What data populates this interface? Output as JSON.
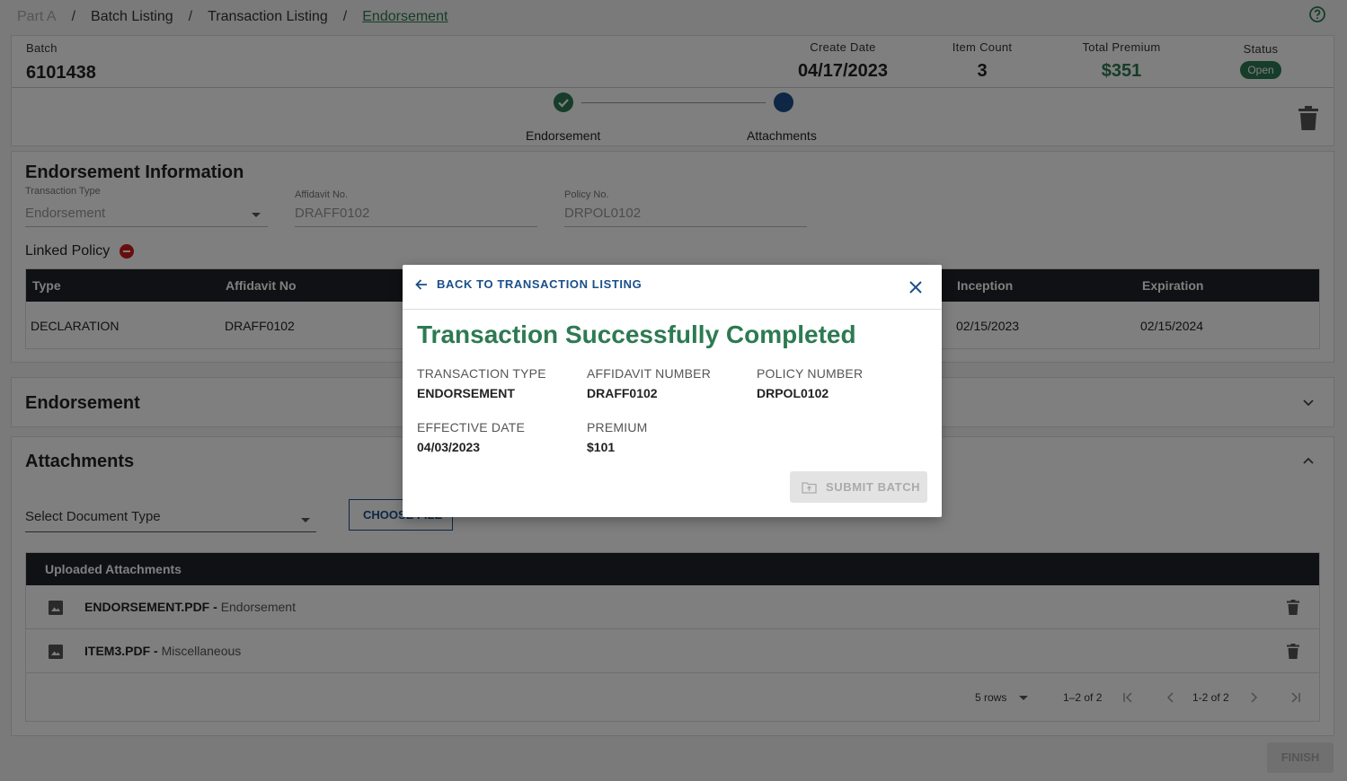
{
  "breadcrumb": {
    "items": [
      "Part A",
      "Batch Listing",
      "Transaction Listing",
      "Endorsement"
    ],
    "separator": "/"
  },
  "batch": {
    "batch_label": "Batch",
    "batch_value": "6101438",
    "create_date_label": "Create Date",
    "create_date_value": "04/17/2023",
    "item_count_label": "Item Count",
    "item_count_value": "3",
    "total_premium_label": "Total Premium",
    "total_premium_value": "$351",
    "status_label": "Status",
    "status_value": "Open"
  },
  "stepper": {
    "steps": [
      "Endorsement",
      "Attachments"
    ]
  },
  "endorsement_info": {
    "title": "Endorsement Information",
    "transaction_type_label": "Transaction Type",
    "transaction_type_value": "Endorsement",
    "affidavit_label": "Affidavit No.",
    "affidavit_value": "DRAFF0102",
    "policy_label": "Policy No.",
    "policy_value": "DRPOL0102",
    "linked_policy_label": "Linked Policy",
    "table": {
      "headers": [
        "Type",
        "Affidavit No",
        "Inception",
        "Expiration"
      ],
      "row": [
        "DECLARATION",
        "DRAFF0102",
        "02/15/2023",
        "02/15/2024"
      ]
    }
  },
  "endorsement_section": {
    "title": "Endorsement"
  },
  "attachments": {
    "title": "Attachments",
    "select_placeholder": "Select Document Type",
    "choose_file_label": "CHOOSE FILE",
    "table_title": "Uploaded Attachments",
    "rows": [
      {
        "file": "ENDORSEMENT.PDF -",
        "type": "Endorsement"
      },
      {
        "file": "ITEM3.PDF -",
        "type": "Miscellaneous"
      }
    ],
    "pager": {
      "rows_per_page": "5 rows",
      "range": "1–2 of 2",
      "range2": "1-2 of 2"
    }
  },
  "finish_label": "FINISH",
  "modal": {
    "back_label": "BACK TO TRANSACTION LISTING",
    "title": "Transaction Successfully Completed",
    "transaction_type_label": "TRANSACTION TYPE",
    "transaction_type_value": "ENDORSEMENT",
    "affidavit_label": "AFFIDAVIT NUMBER",
    "affidavit_value": "DRAFF0102",
    "policy_label": "POLICY NUMBER",
    "policy_value": "DRPOL0102",
    "effective_label": "EFFECTIVE DATE",
    "effective_value": "04/03/2023",
    "premium_label": "PREMIUM",
    "premium_value": "$101",
    "submit_label": "SUBMIT BATCH"
  },
  "colors": {
    "accent_green": "#2d7a52",
    "accent_blue": "#1a4f8a",
    "table_header": "#1f2229",
    "danger": "#d11a1a"
  }
}
